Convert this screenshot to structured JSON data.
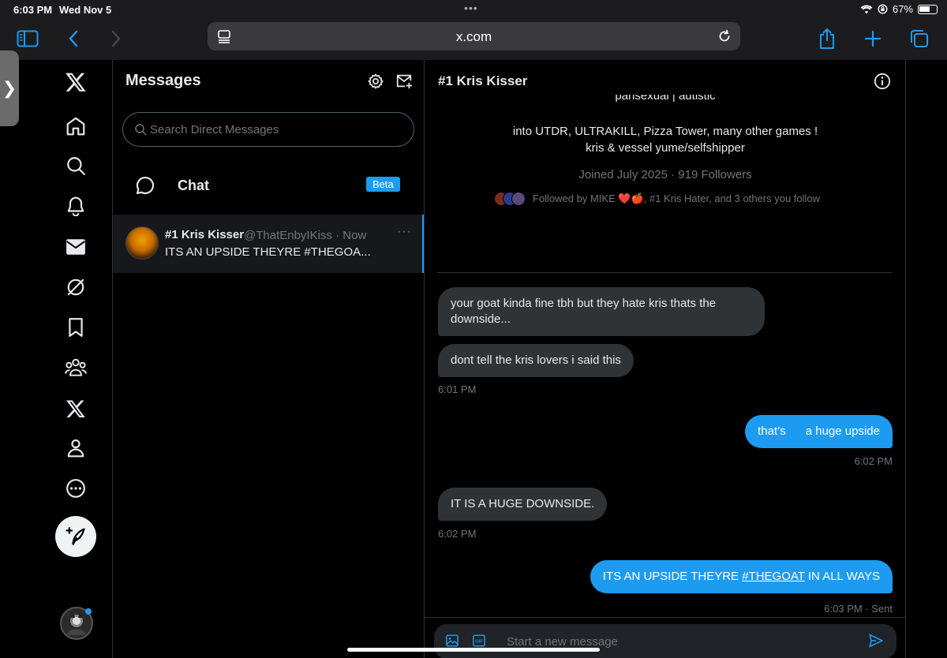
{
  "status_bar": {
    "time": "6:03 PM",
    "date": "Wed Nov 5",
    "battery": "67%",
    "battery_level": 0.67
  },
  "browser": {
    "url": "x.com"
  },
  "nav": {
    "items": [
      "x-logo-icon",
      "home-icon",
      "search-icon",
      "notifications-icon",
      "messages-icon",
      "grok-icon",
      "bookmarks-icon",
      "communities-icon",
      "premium-icon",
      "profile-icon",
      "more-icon"
    ]
  },
  "messages": {
    "title": "Messages",
    "search_placeholder": "Search Direct Messages",
    "chat_label": "Chat",
    "beta_label": "Beta",
    "conversations": [
      {
        "name": "#1 Kris Kisser",
        "handle": "@ThatEnbyIKiss",
        "time": "Now",
        "meta": "@ThatEnbyIKiss · Now",
        "preview": "ITS AN UPSIDE THEYRE #THEGOA..."
      }
    ]
  },
  "conversation": {
    "title": "#1 Kris Kisser",
    "bio_cut": "pansexual | autistic",
    "bio_line1": "into UTDR, ULTRAKILL, Pizza Tower, many other games !",
    "bio_line2": "kris & vessel yume/selfshipper",
    "joined": "Joined July 2025 · 919 Followers",
    "followed_by": "Followed by MIKE ❤️🍎, #1 Kris Hater, and 3 others you follow",
    "messages": [
      {
        "dir": "in",
        "text": "your goat kinda fine  tbh  but   they hate kris thats the downside..."
      },
      {
        "dir": "in",
        "text": "dont tell the kris lovers i said this"
      },
      {
        "dir": "in-ts",
        "text": "6:01 PM"
      },
      {
        "dir": "out",
        "text": "that’s      a huge upside"
      },
      {
        "dir": "out-ts",
        "text": "6:02 PM"
      },
      {
        "dir": "in",
        "text": "IT IS A HUGE DOWNSIDE."
      },
      {
        "dir": "in-ts",
        "text": "6:02 PM"
      },
      {
        "dir": "out",
        "text_before": "ITS AN UPSIDE THEYRE ",
        "link": "#THEGOAT",
        "text_after": " IN ALL WAYS"
      },
      {
        "dir": "out-ts",
        "text": "6:03 PM · Sent"
      }
    ],
    "composer_placeholder": "Start a new message"
  },
  "colors": {
    "accent": "#1d9bf0",
    "bubble_in": "#2f3336",
    "background": "#000000"
  }
}
